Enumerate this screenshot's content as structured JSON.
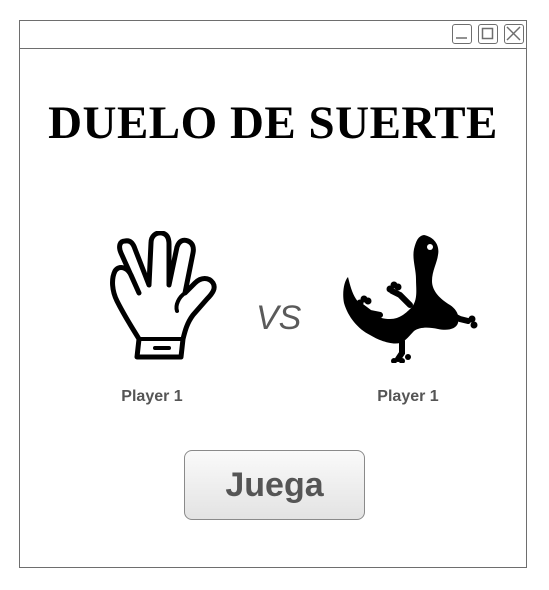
{
  "window": {
    "controls": [
      "minimize-icon",
      "maximize-icon",
      "close-icon"
    ]
  },
  "main": {
    "title": "DUELO DE SUERTE",
    "vs_label": "VS",
    "player_left": {
      "label": "Player 1",
      "icon": "spock-hand-icon"
    },
    "player_right": {
      "label": "Player 1",
      "icon": "lizard-icon"
    },
    "play_button": "Juega"
  }
}
